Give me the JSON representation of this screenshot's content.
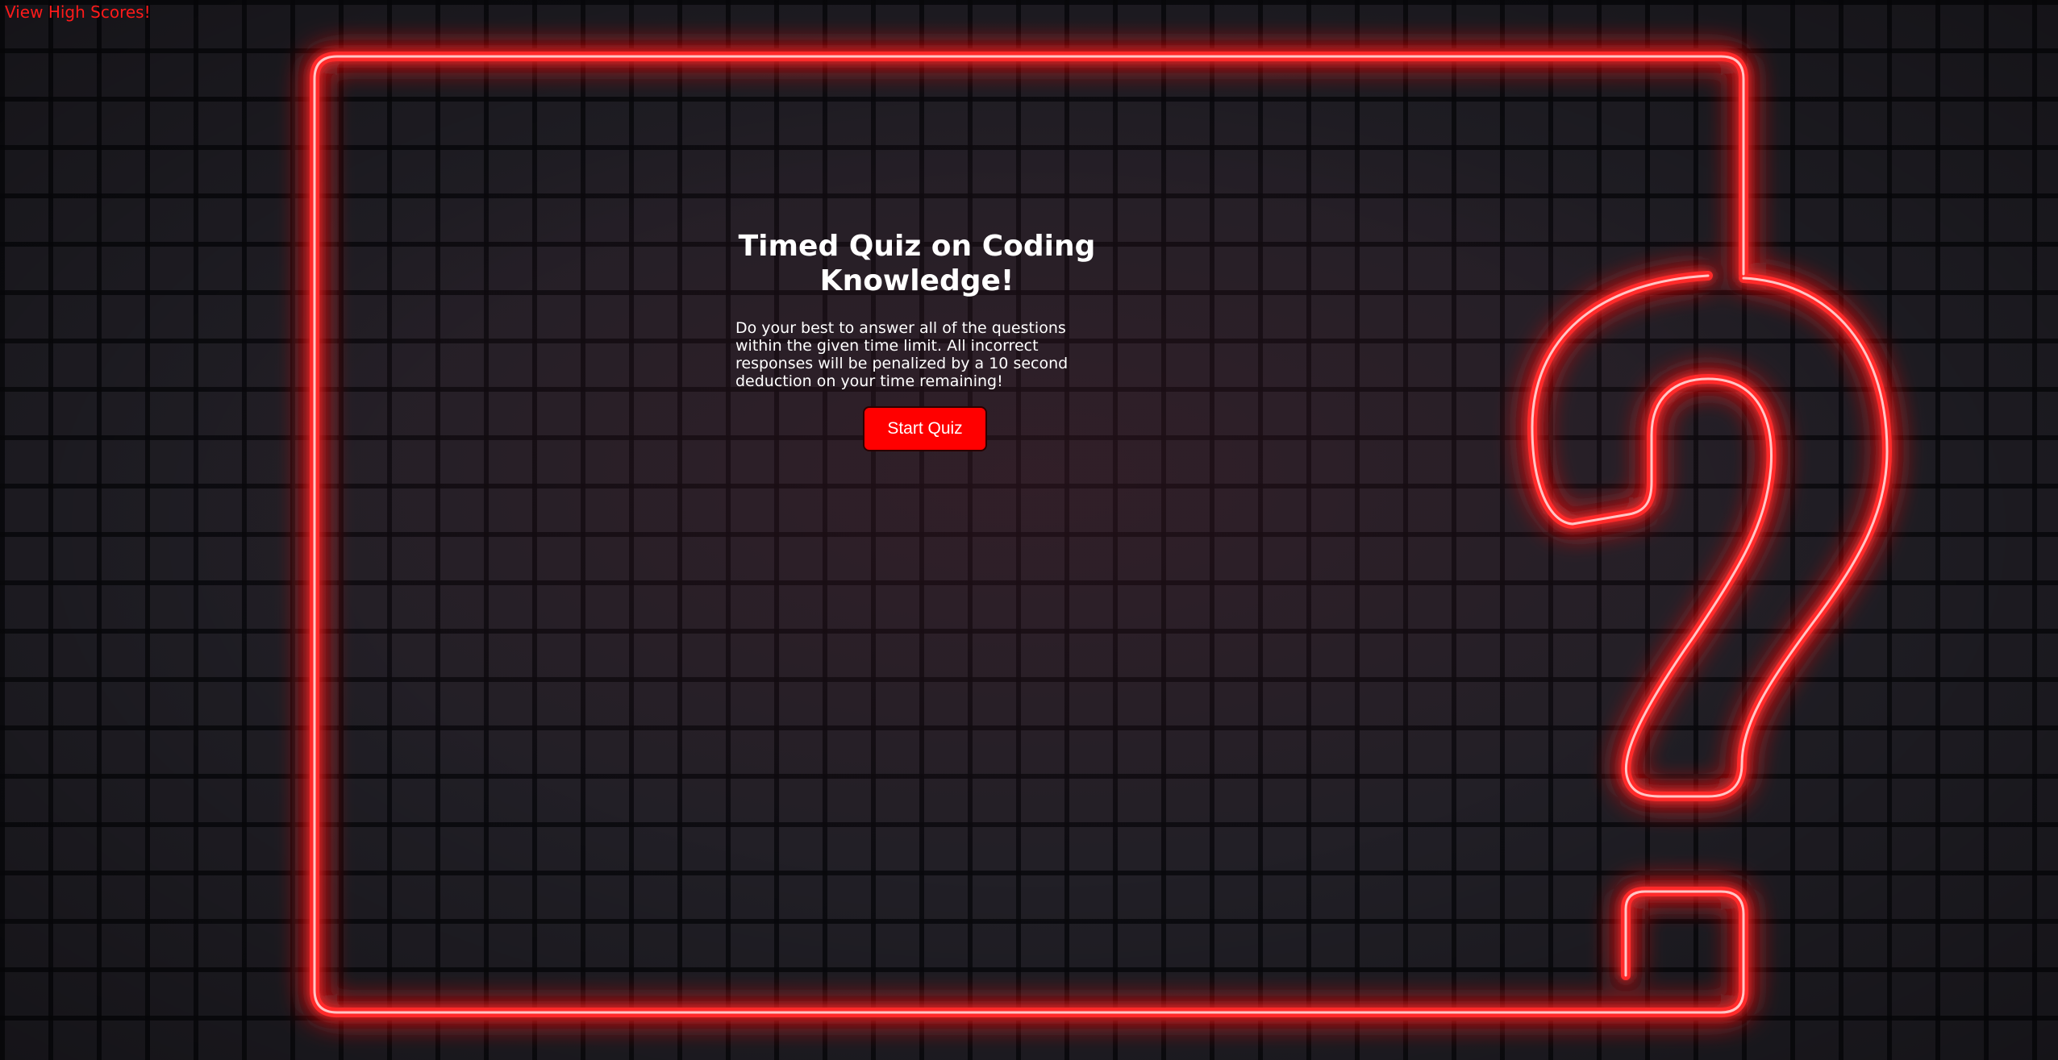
{
  "nav": {
    "high_scores_link": "View High Scores!"
  },
  "intro": {
    "title": "Timed Quiz on Coding Knowledge!",
    "description": "Do your best to answer all of the questions within the given time limit. All incorrect responses will be penalized by a 10 second deduction on your time remaining!",
    "start_button_label": "Start Quiz"
  },
  "theme": {
    "accent": "#ff0000",
    "link_color": "#ff1a1a",
    "text_color": "#ffffff",
    "background": "#211f26"
  },
  "background_image": {
    "icon": "neon-question-mark-frame"
  }
}
